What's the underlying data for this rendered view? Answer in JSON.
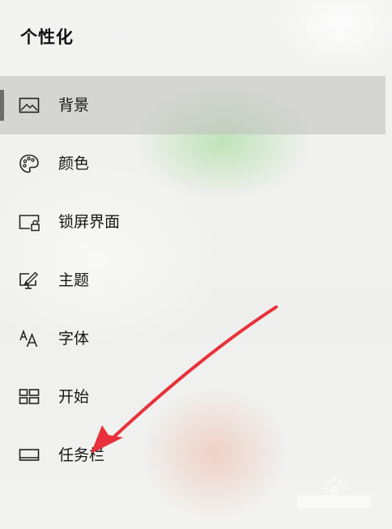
{
  "header": {
    "title": "个性化"
  },
  "nav": {
    "items": [
      {
        "label": "背景",
        "icon": "picture-icon",
        "selected": true
      },
      {
        "label": "颜色",
        "icon": "palette-icon",
        "selected": false
      },
      {
        "label": "锁屏界面",
        "icon": "lock-screen-icon",
        "selected": false
      },
      {
        "label": "主题",
        "icon": "theme-brush-icon",
        "selected": false
      },
      {
        "label": "字体",
        "icon": "font-icon",
        "selected": false
      },
      {
        "label": "开始",
        "icon": "start-tiles-icon",
        "selected": false
      },
      {
        "label": "任务栏",
        "icon": "taskbar-icon",
        "selected": false
      }
    ]
  },
  "colors": {
    "selected_bar": "#6d6d6d",
    "arrow": "#e8313a"
  }
}
